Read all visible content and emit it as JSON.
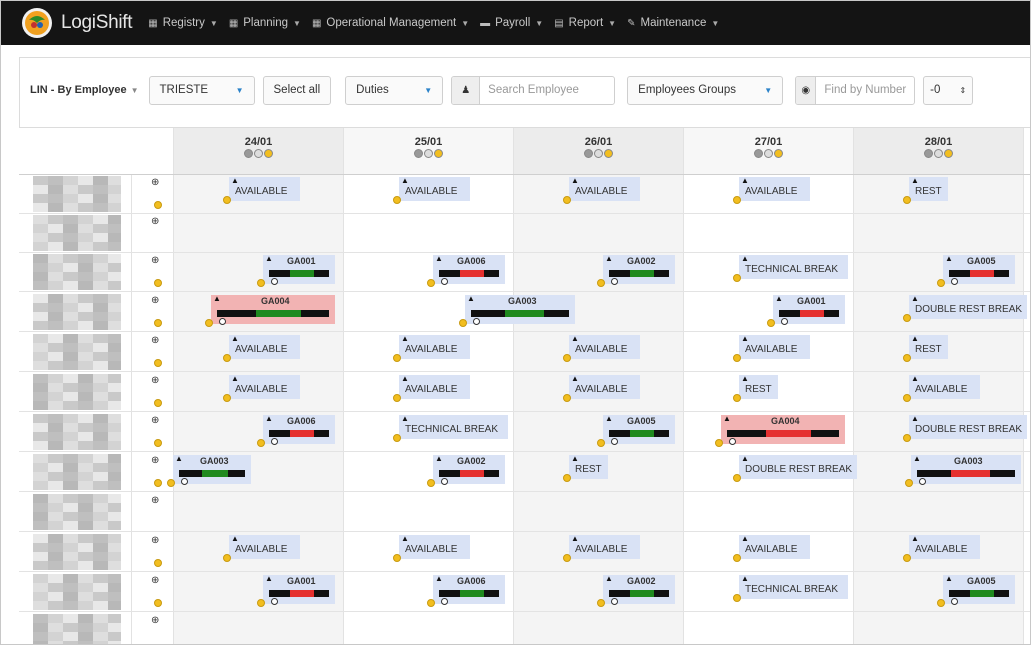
{
  "app": {
    "brand": "LogiShift"
  },
  "nav": [
    {
      "icon": "calendar-icon",
      "label": "Registry"
    },
    {
      "icon": "calendar-icon",
      "label": "Planning"
    },
    {
      "icon": "calendar-icon",
      "label": "Operational Management"
    },
    {
      "icon": "money-icon",
      "label": "Payroll"
    },
    {
      "icon": "file-icon",
      "label": "Report"
    },
    {
      "icon": "wrench-icon",
      "label": "Maintenance"
    }
  ],
  "toolbar": {
    "view_label": "LIN - By Employee",
    "location": "TRIESTE",
    "select_all": "Select all",
    "duties": "Duties",
    "search_placeholder": "Search Employee",
    "groups": "Employees Groups",
    "find_placeholder": "Find by Number",
    "offset_value": "-0"
  },
  "days": [
    {
      "date": "24/01",
      "dots": [
        "#999",
        "#ddd",
        "#f2be1f"
      ]
    },
    {
      "date": "25/01",
      "dots": [
        "#999",
        "#ddd",
        "#f2be1f"
      ]
    },
    {
      "date": "26/01",
      "dots": [
        "#999",
        "#ddd",
        "#f2be1f"
      ]
    },
    {
      "date": "27/01",
      "dots": [
        "#999",
        "#ddd",
        "#f2be1f"
      ]
    },
    {
      "date": "28/01",
      "dots": [
        "#999",
        "#ddd",
        "#f2be1f"
      ]
    }
  ],
  "colors": {
    "available": "#d9e2f5",
    "conflict": "#f2b3b3",
    "work": "#1f8a1f",
    "alert": "#e53030",
    "warning": "#f2be1f"
  },
  "shifts": [
    {
      "row": 0,
      "day": 0,
      "label": "AVAILABLE",
      "type": "text"
    },
    {
      "row": 0,
      "day": 1,
      "label": "AVAILABLE",
      "type": "text"
    },
    {
      "row": 0,
      "day": 2,
      "label": "AVAILABLE",
      "type": "text"
    },
    {
      "row": 0,
      "day": 3,
      "label": "AVAILABLE",
      "type": "text"
    },
    {
      "row": 0,
      "day": 4,
      "label": "REST",
      "type": "text"
    },
    {
      "row": 2,
      "day": 0,
      "label": "GA001",
      "type": "duty"
    },
    {
      "row": 2,
      "day": 1,
      "label": "GA006",
      "type": "duty"
    },
    {
      "row": 2,
      "day": 2,
      "label": "GA002",
      "type": "duty"
    },
    {
      "row": 2,
      "day": 3,
      "label": "TECHNICAL BREAK",
      "type": "text"
    },
    {
      "row": 2,
      "day": 4,
      "label": "GA005",
      "type": "duty"
    },
    {
      "row": 3,
      "day": 0,
      "label": "GA004",
      "type": "duty"
    },
    {
      "row": 3,
      "day": 1,
      "label": "GA003",
      "type": "duty"
    },
    {
      "row": 3,
      "day": 3,
      "label": "GA001",
      "type": "duty"
    },
    {
      "row": 3,
      "day": 4,
      "label": "DOUBLE REST BREAK",
      "type": "text"
    },
    {
      "row": 4,
      "day": 0,
      "label": "AVAILABLE",
      "type": "text"
    },
    {
      "row": 4,
      "day": 1,
      "label": "AVAILABLE",
      "type": "text"
    },
    {
      "row": 4,
      "day": 2,
      "label": "AVAILABLE",
      "type": "text"
    },
    {
      "row": 4,
      "day": 3,
      "label": "AVAILABLE",
      "type": "text"
    },
    {
      "row": 4,
      "day": 4,
      "label": "REST",
      "type": "text"
    },
    {
      "row": 5,
      "day": 0,
      "label": "AVAILABLE",
      "type": "text"
    },
    {
      "row": 5,
      "day": 1,
      "label": "AVAILABLE",
      "type": "text"
    },
    {
      "row": 5,
      "day": 2,
      "label": "AVAILABLE",
      "type": "text"
    },
    {
      "row": 5,
      "day": 3,
      "label": "REST",
      "type": "text"
    },
    {
      "row": 5,
      "day": 4,
      "label": "AVAILABLE",
      "type": "text"
    },
    {
      "row": 6,
      "day": 0,
      "label": "GA006",
      "type": "duty"
    },
    {
      "row": 6,
      "day": 1,
      "label": "TECHNICAL BREAK",
      "type": "text"
    },
    {
      "row": 6,
      "day": 2,
      "label": "GA005",
      "type": "duty"
    },
    {
      "row": 6,
      "day": 3,
      "label": "GA004",
      "type": "duty"
    },
    {
      "row": 6,
      "day": 4,
      "label": "DOUBLE REST BREAK",
      "type": "text"
    },
    {
      "row": 7,
      "day": 0,
      "label": "GA003",
      "type": "duty"
    },
    {
      "row": 7,
      "day": 1,
      "label": "GA002",
      "type": "duty"
    },
    {
      "row": 7,
      "day": 2,
      "label": "REST",
      "type": "text"
    },
    {
      "row": 7,
      "day": 3,
      "label": "DOUBLE REST BREAK",
      "type": "text"
    },
    {
      "row": 7,
      "day": 4,
      "label": "GA003",
      "type": "duty"
    },
    {
      "row": 9,
      "day": 0,
      "label": "AVAILABLE",
      "type": "text"
    },
    {
      "row": 9,
      "day": 1,
      "label": "AVAILABLE",
      "type": "text"
    },
    {
      "row": 9,
      "day": 2,
      "label": "AVAILABLE",
      "type": "text"
    },
    {
      "row": 9,
      "day": 3,
      "label": "AVAILABLE",
      "type": "text"
    },
    {
      "row": 9,
      "day": 4,
      "label": "AVAILABLE",
      "type": "text"
    },
    {
      "row": 10,
      "day": 0,
      "label": "GA001",
      "type": "duty"
    },
    {
      "row": 10,
      "day": 1,
      "label": "GA006",
      "type": "duty"
    },
    {
      "row": 10,
      "day": 2,
      "label": "GA002",
      "type": "duty"
    },
    {
      "row": 10,
      "day": 3,
      "label": "TECHNICAL BREAK",
      "type": "text"
    },
    {
      "row": 10,
      "day": 4,
      "label": "GA005",
      "type": "duty"
    }
  ]
}
